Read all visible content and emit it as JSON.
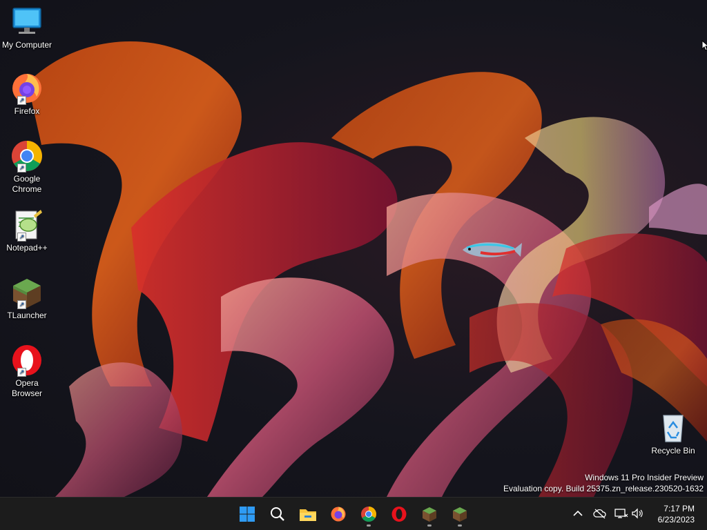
{
  "desktop_icons": {
    "my_computer": "My Computer",
    "firefox": "Firefox",
    "chrome": "Google Chrome",
    "notepadpp": "Notepad++",
    "tlauncher": "TLauncher",
    "opera": "Opera Browser",
    "recycle_bin": "Recycle Bin"
  },
  "watermark": {
    "line1": "Windows 11 Pro Insider Preview",
    "line2": "Evaluation copy. Build 25375.zn_release.230520-1632"
  },
  "taskbar": {
    "apps": [
      "start-icon",
      "search-icon",
      "file-explorer-icon",
      "firefox-icon",
      "chrome-icon",
      "opera-icon",
      "tlauncher-icon",
      "tlauncher-icon"
    ],
    "time": "7:17 PM",
    "date": "6/23/2023"
  },
  "colors": {
    "taskbar_bg": "#1c1c1c",
    "start_blue": "#2f9bf4",
    "desktop_bg": "#14141c"
  }
}
